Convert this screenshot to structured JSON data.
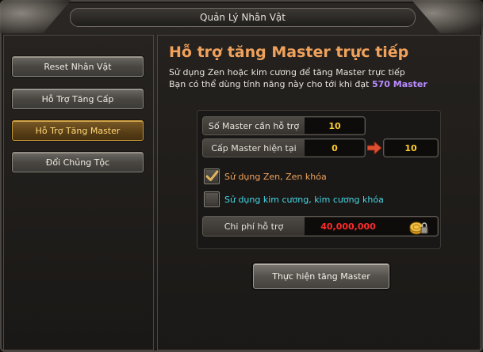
{
  "window": {
    "title": "Quản Lý Nhân Vật"
  },
  "sidebar": {
    "items": [
      {
        "label": "Reset Nhân Vật",
        "active": false
      },
      {
        "label": "Hỗ Trợ Tăng Cấp",
        "active": false
      },
      {
        "label": "Hỗ Trợ Tăng Master",
        "active": true
      },
      {
        "label": "Đổi Chủng Tộc",
        "active": false
      }
    ]
  },
  "main": {
    "heading": "Hỗ trợ tăng Master trực tiếp",
    "desc_line1": "Sử dụng Zen hoặc kim cương để tăng Master trực tiếp",
    "desc_line2_prefix": "Bạn có thể dùng tính năng này cho tới khi đạt ",
    "desc_line2_highlight": "570 Master",
    "fields": {
      "master_needed_label": "Số Master cần hỗ trợ",
      "master_needed_value": "10",
      "current_master_label": "Cấp Master hiện tại",
      "current_master_value": "0",
      "target_master_value": "10",
      "cost_label": "Chi phí hỗ trợ",
      "cost_value": "40,000,000"
    },
    "options": {
      "zen_label": "Sử dụng Zen, Zen khóa",
      "zen_checked": true,
      "diamond_label": "Sử dụng kim cương, kim cương khóa",
      "diamond_checked": false
    },
    "execute_button": "Thực hiện tăng Master"
  },
  "colors": {
    "heading": "#f0a25c",
    "highlight": "#b98cff",
    "value_yellow": "#ffcc2e",
    "cost_red": "#ff2a2a",
    "diamond_text": "#45d7e6",
    "arrow": "#e05030"
  },
  "icons": [
    "check-icon",
    "right-arrow-icon",
    "coin-lock-icon"
  ]
}
